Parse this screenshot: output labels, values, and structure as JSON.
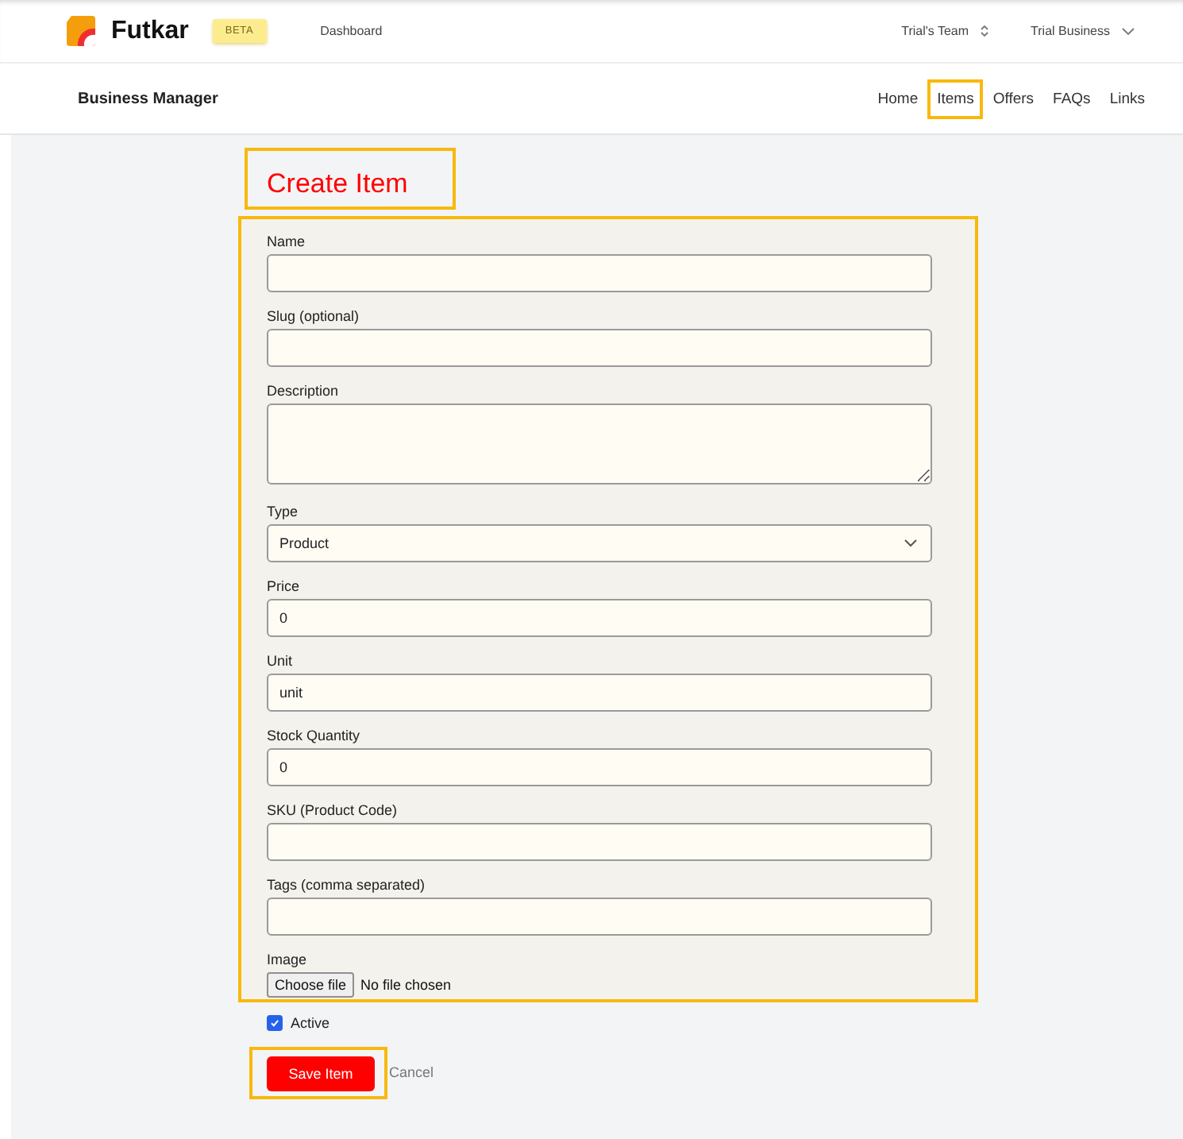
{
  "header": {
    "brand": "Futkar",
    "badge": "BETA",
    "nav": [
      {
        "label": "Dashboard"
      }
    ],
    "team": "Trial's Team",
    "business": "Trial Business"
  },
  "subheader": {
    "title": "Business Manager",
    "links": [
      {
        "label": "Home",
        "selected": false
      },
      {
        "label": "Items",
        "selected": true
      },
      {
        "label": "Offers",
        "selected": false
      },
      {
        "label": "FAQs",
        "selected": false
      },
      {
        "label": "Links",
        "selected": false
      }
    ]
  },
  "form": {
    "title": "Create Item",
    "fields": [
      {
        "kind": "text",
        "label": "Name"
      },
      {
        "kind": "text",
        "label": "Slug (optional)"
      },
      {
        "kind": "textarea",
        "label": "Description"
      },
      {
        "kind": "select",
        "label": "Type",
        "value": "Product"
      },
      {
        "kind": "text",
        "label": "Price",
        "value": "0"
      },
      {
        "kind": "text",
        "label": "Unit",
        "value": "unit"
      },
      {
        "kind": "text",
        "label": "Stock Quantity",
        "value": "0"
      },
      {
        "kind": "text",
        "label": "SKU (Product Code)"
      },
      {
        "kind": "text",
        "label": "Tags (comma separated)"
      },
      {
        "kind": "file",
        "label": "Image",
        "button": "Choose file",
        "status": "No file chosen"
      }
    ],
    "active": {
      "label": "Active",
      "checked": true
    },
    "save": "Save Item",
    "cancel": "Cancel"
  }
}
